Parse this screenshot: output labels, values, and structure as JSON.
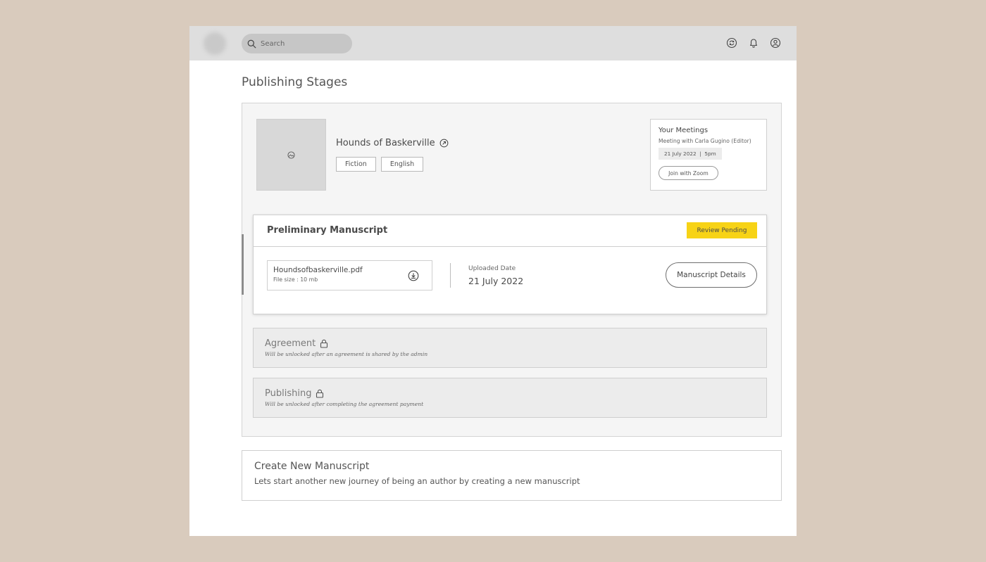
{
  "header": {
    "search": {
      "placeholder": "Search"
    },
    "icons": [
      "refresh-icon",
      "bell-icon",
      "user-icon"
    ]
  },
  "page": {
    "title": "Publishing Stages"
  },
  "book": {
    "title": "Hounds of Baskerville",
    "tags": [
      "Fiction",
      "English"
    ]
  },
  "meetings": {
    "title": "Your Meetings",
    "description": "Meeting with Carla Gugino (Editor)",
    "time": "21 July 2022  |  5pm",
    "join_label": "Join with Zoom"
  },
  "stages": {
    "preliminary": {
      "title": "Preliminary Manuscript",
      "status": "Review Pending",
      "status_color": "#f7d316",
      "file_name": "Houndsofbaskerville.pdf",
      "file_size": "File size : 10 mb",
      "uploaded_label": "Uploaded Date",
      "uploaded_date": "21 July 2022",
      "details_label": "Manuscript Details"
    },
    "agreement": {
      "title": "Agreement",
      "note": "Will be unlocked after an agreement is shared by the admin"
    },
    "publishing": {
      "title": "Publishing",
      "note": "Will be unlocked after completing the agreement payment"
    }
  },
  "create": {
    "title": "Create New Manuscript",
    "description": "Lets start another new journey of being an author by creating a new manuscript"
  }
}
